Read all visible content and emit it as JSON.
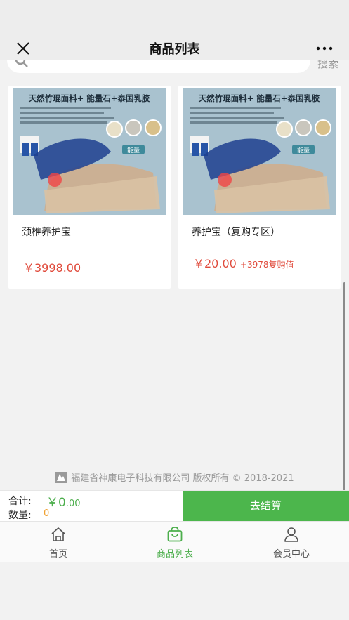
{
  "header": {
    "title": "商品列表",
    "close_icon": "close-icon",
    "more_icon": "more-icon"
  },
  "search": {
    "button_label": "搜索",
    "icon": "search-icon"
  },
  "products": [
    {
      "name": "颈椎养护宝",
      "price": "￥3998.00",
      "extra": "",
      "image_text": {
        "headline": "天然竹琨面料+ 能量石+泰国乳胶",
        "badge": "能量"
      }
    },
    {
      "name": "养护宝（复购专区）",
      "price": "￥20.00",
      "extra": "+3978复购值",
      "image_text": {
        "headline": "天然竹琨面料+ 能量石+泰国乳胶",
        "badge": "能量"
      }
    }
  ],
  "footer": {
    "copyright": "福建省神康电子科技有限公司 版权所有 © 2018-2021"
  },
  "cart": {
    "total_label": "合计:",
    "total_currency": "￥",
    "total_int": "0",
    "total_dec": ".00",
    "qty_label": "数量:",
    "qty_value": "0",
    "checkout_label": "去结算"
  },
  "tabbar": [
    {
      "label": "首页",
      "icon": "home-icon",
      "active": false
    },
    {
      "label": "商品列表",
      "icon": "shopping-bag-icon",
      "active": true
    },
    {
      "label": "会员中心",
      "icon": "user-icon",
      "active": false
    }
  ],
  "colors": {
    "accent": "#4cb64c",
    "price": "#e04a3b",
    "qty": "#f0a030"
  }
}
